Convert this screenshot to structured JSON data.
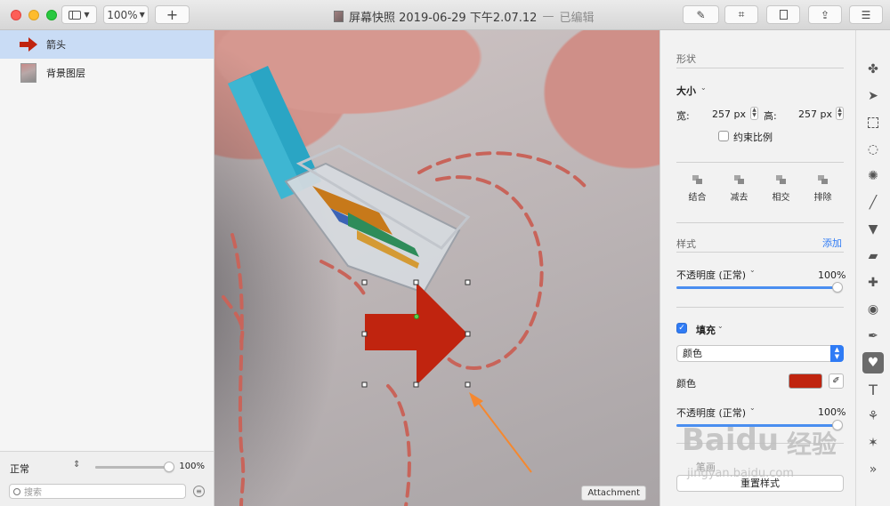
{
  "toolbar": {
    "zoom": "100%",
    "add": "+",
    "title": "屏幕快照 2019-06-29 下午2.07.12",
    "title_separator": "—",
    "edited_status": "已编辑"
  },
  "layers": {
    "items": [
      {
        "label": "箭头",
        "icon": "arrow-icon",
        "selected": true
      },
      {
        "label": "背景图层",
        "icon": "photo-thumbnail",
        "selected": false
      }
    ]
  },
  "sidebar_bottom": {
    "blend_mode": "正常",
    "opacity": "100%",
    "opacity_value": 1.0,
    "search_placeholder": "搜索"
  },
  "canvas": {
    "attachment_label": "Attachment",
    "arrow_color": "#c0240f"
  },
  "inspector": {
    "shape_title": "形状",
    "size_label": "大小",
    "width_label": "宽:",
    "width_value": "257 px",
    "height_label": "高:",
    "height_value": "257 px",
    "constrain_label": "约束比例",
    "path_ops": [
      "结合",
      "减去",
      "相交",
      "排除"
    ],
    "style_title": "样式",
    "add_link": "添加",
    "opacity_label": "不透明度 (正常)",
    "opacity_value": "100%",
    "fill_label": "填充",
    "fill_type": "颜色",
    "color_label": "颜色",
    "fill_color": "#c0240f",
    "fill_opacity_label": "不透明度 (正常)",
    "fill_opacity_value": "100%",
    "partial_label": "笔画",
    "reset_button": "重置样式"
  },
  "watermark": {
    "brand": "Baidu",
    "brand_cn": "经验",
    "url": "jingyan.baidu.com"
  },
  "accent_color": "#2f7bf5"
}
